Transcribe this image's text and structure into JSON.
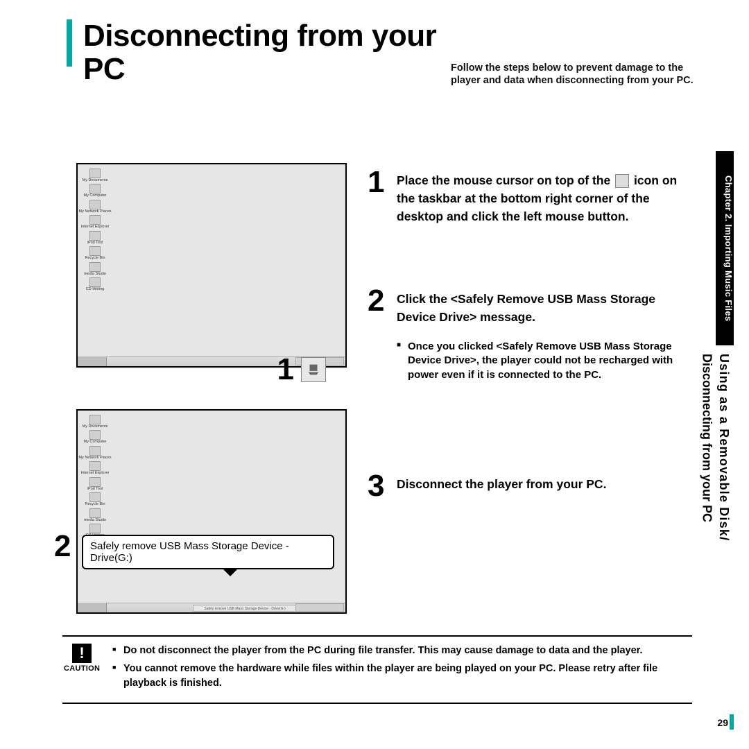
{
  "title": "Disconnecting from your PC",
  "subtitle": "Follow the steps below to prevent damage to the player and data when disconnecting from your PC.",
  "desktop_icons": [
    "My Documents",
    "My Computer",
    "My Network Places",
    "Internet Explorer",
    "iPod Tool",
    "Recycle Bin",
    "media Studio",
    "CD Writing"
  ],
  "callouts": {
    "one": "1",
    "two": "2"
  },
  "balloon_text": "Safely remove USB Mass Storage Device - Drive(G:)",
  "tray_label": "Safely remove USB Mass Storage Device - Drive(G:)",
  "steps": {
    "s1": {
      "num": "1",
      "text_a": "Place the mouse cursor on top of the ",
      "text_b": " icon on the taskbar at the bottom right corner of the desktop and click the left mouse button."
    },
    "s2": {
      "num": "2",
      "text": "Click the <Safely Remove USB Mass Storage Device Drive> message.",
      "note": "Once you clicked <Safely Remove USB Mass Storage Device Drive>, the player could not be recharged with power even if it is connected to the PC."
    },
    "s3": {
      "num": "3",
      "text": "Disconnect the player from your PC."
    }
  },
  "side_tab": "Chapter 2. Importing Music Files",
  "side_label": {
    "line1": "Using as a Removable Disk/",
    "line2": "Disconnecting from your PC"
  },
  "caution": {
    "label": "CAUTION",
    "mark": "!",
    "items": [
      "Do not disconnect the player from the PC during file transfer. This may cause damage to data and the player.",
      "You cannot remove the hardware while files within the player are being played on your PC. Please retry after file playback is finished."
    ]
  },
  "page_number": "29"
}
